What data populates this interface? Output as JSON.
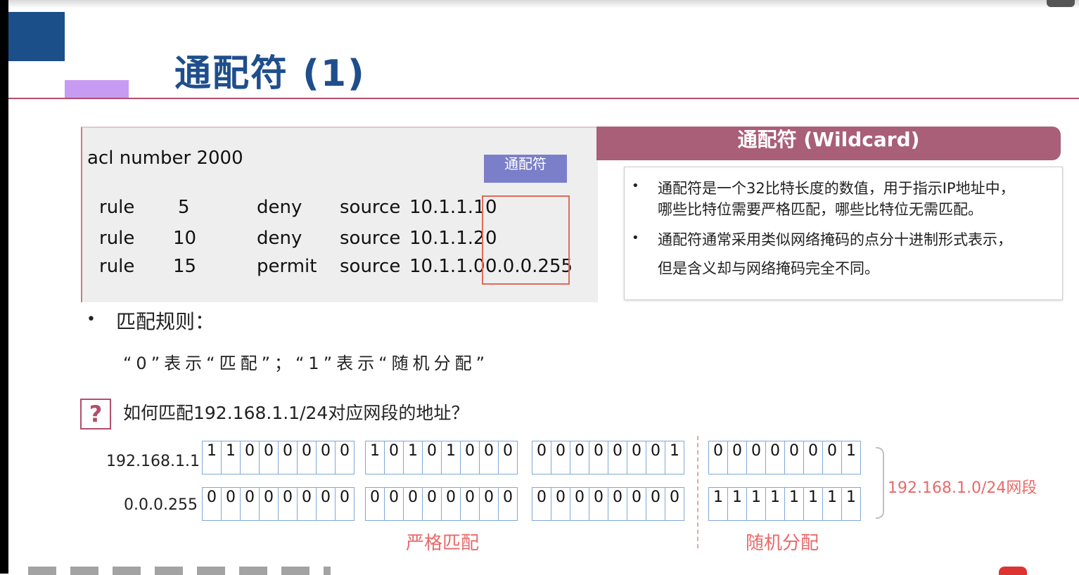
{
  "slide": {
    "title": "通配符 (1)"
  },
  "acl": {
    "header": "acl number 2000",
    "tag": "通配符",
    "rules": [
      {
        "keyword": "rule",
        "id": "5",
        "action": "deny",
        "src": "source",
        "ip": "10.1.1.1",
        "wildcard": "0"
      },
      {
        "keyword": "rule",
        "id": "10",
        "action": "deny",
        "src": "source",
        "ip": "10.1.1.2",
        "wildcard": "0"
      },
      {
        "keyword": "rule",
        "id": "15",
        "action": "permit",
        "src": "source",
        "ip": "10.1.1.0",
        "wildcard": "0.0.0.255"
      }
    ]
  },
  "wildcard_panel": {
    "header": "通配符 (Wildcard)",
    "bullet1_line1": "通配符是一个32比特长度的数值，用于指示IP地址中，",
    "bullet1_line2": "哪些比特位需要严格匹配，哪些比特位无需匹配。",
    "bullet2_line1": "通配符通常采用类似网络掩码的点分十进制形式表示，",
    "bullet2_line2": "但是含义却与网络掩码完全不同。"
  },
  "match": {
    "bullet": "•",
    "title": "匹配规则：",
    "desc": "“0”表示“匹配”；“1”表示“随机分配”"
  },
  "question": {
    "icon": "?",
    "text": "如何匹配192.168.1.1/24对应网段的地址？"
  },
  "binary": {
    "rows": [
      {
        "label": "192.168.1.1",
        "octets": [
          [
            "1",
            "1",
            "0",
            "0",
            "0",
            "0",
            "0",
            "0"
          ],
          [
            "1",
            "0",
            "1",
            "0",
            "1",
            "0",
            "0",
            "0"
          ],
          [
            "0",
            "0",
            "0",
            "0",
            "0",
            "0",
            "0",
            "1"
          ],
          [
            "0",
            "0",
            "0",
            "0",
            "0",
            "0",
            "0",
            "1"
          ]
        ]
      },
      {
        "label": "0.0.0.255",
        "octets": [
          [
            "0",
            "0",
            "0",
            "0",
            "0",
            "0",
            "0",
            "0"
          ],
          [
            "0",
            "0",
            "0",
            "0",
            "0",
            "0",
            "0",
            "0"
          ],
          [
            "0",
            "0",
            "0",
            "0",
            "0",
            "0",
            "0",
            "0"
          ],
          [
            "1",
            "1",
            "1",
            "1",
            "1",
            "1",
            "1",
            "1"
          ]
        ]
      }
    ],
    "strict_label": "严格匹配",
    "random_label": "随机分配",
    "network_label": "192.168.1.0/24网段"
  },
  "colors": {
    "title": "#1f4e8c",
    "accent": "#b0506a",
    "wildcard_header": "#a95f78",
    "highlight_red": "#e86a6a"
  }
}
